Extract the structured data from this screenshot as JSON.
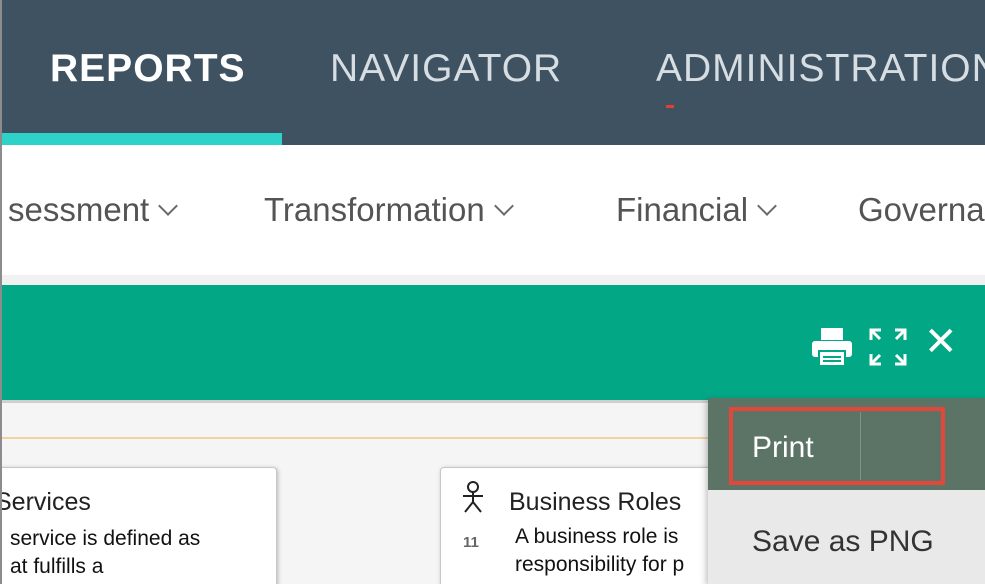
{
  "topnav": {
    "tabs": [
      {
        "label": "REPORTS"
      },
      {
        "label": "NAVIGATOR"
      },
      {
        "label": "ADMINISTRATION"
      }
    ],
    "active_color": "#2fd2c9"
  },
  "subnav": {
    "items": [
      {
        "label": "sessment"
      },
      {
        "label": "Transformation"
      },
      {
        "label": "Financial"
      },
      {
        "label": "Governa"
      }
    ]
  },
  "panel": {
    "color": "#02a886",
    "icons": [
      "print-icon",
      "expand-icon",
      "close-icon"
    ],
    "close_glyph": "✕"
  },
  "cards": {
    "services": {
      "title": "Services",
      "desc_line1": "service is defined as",
      "desc_line2": "at fulfills a"
    },
    "roles": {
      "title": "Business Roles",
      "count": "11",
      "desc_line1": "A business role is",
      "desc_line2": "responsibility for p"
    }
  },
  "menu": {
    "items": [
      {
        "label": "Print"
      },
      {
        "label": "Save as PNG"
      }
    ],
    "highlight_color": "#e2473b"
  }
}
